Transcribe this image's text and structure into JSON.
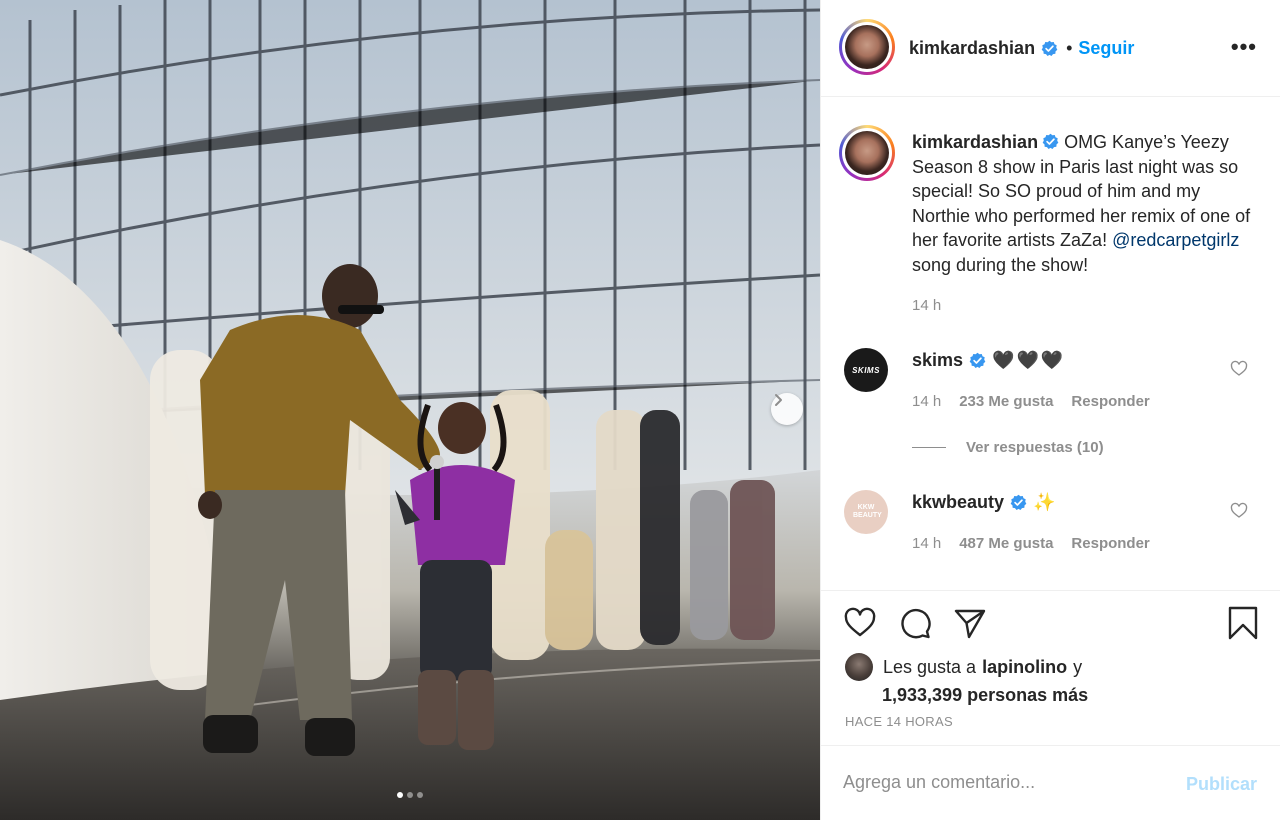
{
  "post": {
    "dots": 3,
    "active_dot": 0
  },
  "header": {
    "username": "kimkardashian",
    "separator": "•",
    "follow_label": "Seguir",
    "more_label": "•••"
  },
  "caption": {
    "username": "kimkardashian",
    "text": "OMG Kanye’s Yeezy Season 8 show in Paris last night was so special! So SO proud of him and my Northie who performed her remix of one of her favorite artists ZaZa!",
    "mention": "@redcarpetgirlz",
    "text_after": "song during the show!",
    "time": "14 h"
  },
  "comments": [
    {
      "username": "skims",
      "avatar_text": "SKIMS",
      "emoji": "🖤🖤🖤",
      "time": "14 h",
      "likes": "233 Me gusta",
      "reply_label": "Responder"
    },
    {
      "username": "kkwbeauty",
      "avatar_text": "KKW BEAUTY",
      "emoji": "✨",
      "time": "14 h",
      "likes": "487 Me gusta",
      "reply_label": "Responder"
    }
  ],
  "view_replies": "Ver respuestas (10)",
  "likes": {
    "prefix": "Les gusta a",
    "liker": "lapinolino",
    "suffix": "y",
    "others": "1,933,399 personas más"
  },
  "posted": "HACE 14 HORAS",
  "comment_box": {
    "placeholder": "Agrega un comentario...",
    "publish_label": "Publicar"
  },
  "colors": {
    "link": "#0095f6",
    "mention": "#00376b",
    "muted": "#8e8e8e",
    "publish_disabled": "#b2dffc"
  }
}
